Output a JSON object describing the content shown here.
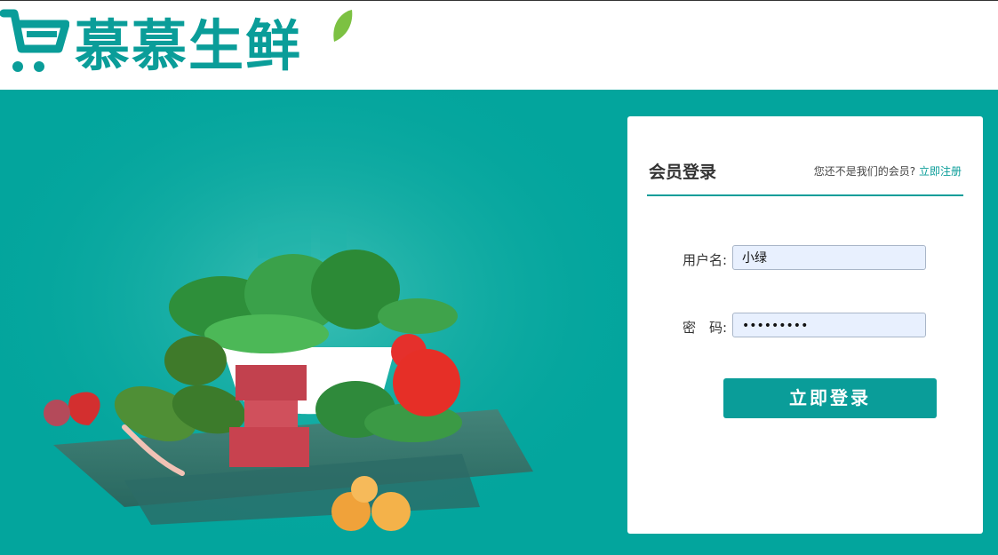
{
  "header": {
    "brand_name": "慕慕生鲜",
    "brand_color": "#0a9d99",
    "logo_icon": "shopping-cart-icon"
  },
  "hero": {
    "background_color": "#03a59d",
    "image_subject": "fresh-vegetables-meat-illustration"
  },
  "login": {
    "title": "会员登录",
    "register_prompt": "您还不是我们的会员?",
    "register_link": "立即注册",
    "username_label": "用户名:",
    "username_value": "小绿",
    "password_label": "密　码:",
    "password_value": "•••••••••",
    "submit_label": "立即登录"
  }
}
